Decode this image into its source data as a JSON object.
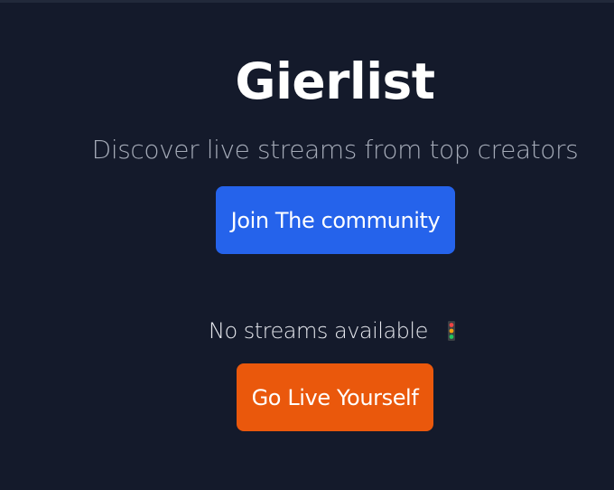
{
  "app": {
    "title": "Gierlist",
    "tagline": "Discover live streams from top creators"
  },
  "actions": {
    "join_label": "Join The community",
    "go_live_label": "Go Live Yourself"
  },
  "streams": {
    "empty_message": "No streams available",
    "status_icon": "traffic-light-icon"
  },
  "colors": {
    "background": "#141a2b",
    "join_button": "#2563eb",
    "go_live_button": "#ea580c"
  }
}
